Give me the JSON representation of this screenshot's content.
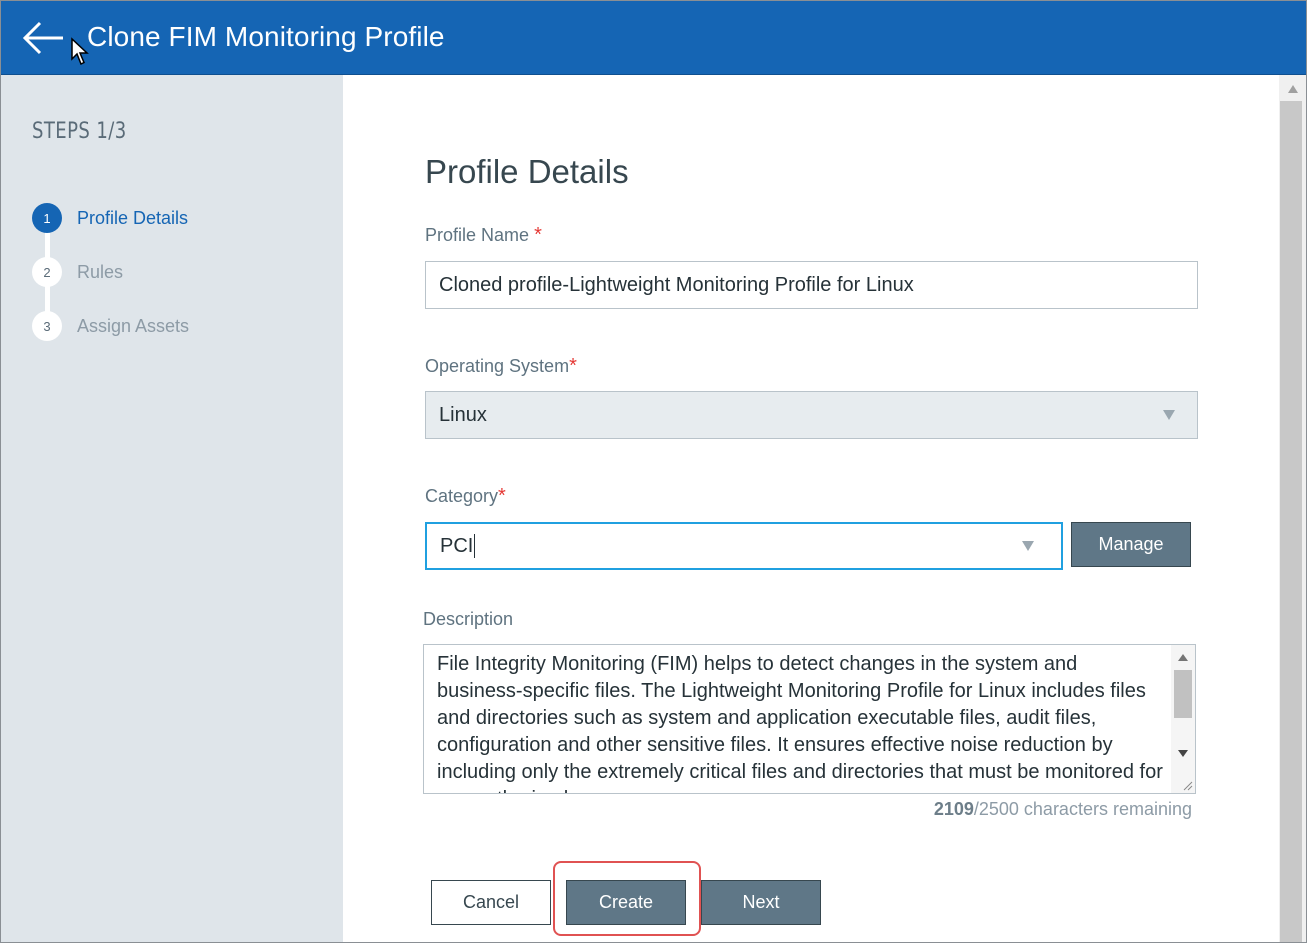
{
  "header": {
    "title": "Clone FIM Monitoring Profile",
    "back_icon": "arrow-left-icon",
    "background": "#1565b4"
  },
  "sidebar": {
    "steps_label": "STEPS 1/3",
    "steps": [
      {
        "number": "1",
        "label": "Profile Details",
        "active": true
      },
      {
        "number": "2",
        "label": "Rules",
        "active": false
      },
      {
        "number": "3",
        "label": "Assign Assets",
        "active": false
      }
    ]
  },
  "form": {
    "section_title": "Profile Details",
    "profile_name": {
      "label": "Profile Name",
      "required_mark": "*",
      "value": "Cloned profile-Lightweight Monitoring Profile for Linux"
    },
    "operating_system": {
      "label": "Operating System",
      "required_mark": "*",
      "value": "Linux"
    },
    "category": {
      "label": "Category",
      "required_mark": "*",
      "value": "PCI",
      "manage_label": "Manage"
    },
    "description": {
      "label": "Description",
      "text": "File Integrity Monitoring (FIM) helps to detect changes in the system and business-specific files. The Lightweight Monitoring Profile for Linux includes files and directories such as system and application executable files, audit files, configuration and other sensitive files. It ensures effective noise reduction by including only the extremely critical files and directories that must be monitored for any authorized",
      "chars_remaining": "2109",
      "chars_max_text": "/2500 characters remaining"
    }
  },
  "actions": {
    "cancel_label": "Cancel",
    "create_label": "Create",
    "next_label": "Next"
  },
  "colors": {
    "primary": "#1565b4",
    "button": "#5f7787",
    "focus": "#20a0e0",
    "highlight": "#e05252"
  }
}
